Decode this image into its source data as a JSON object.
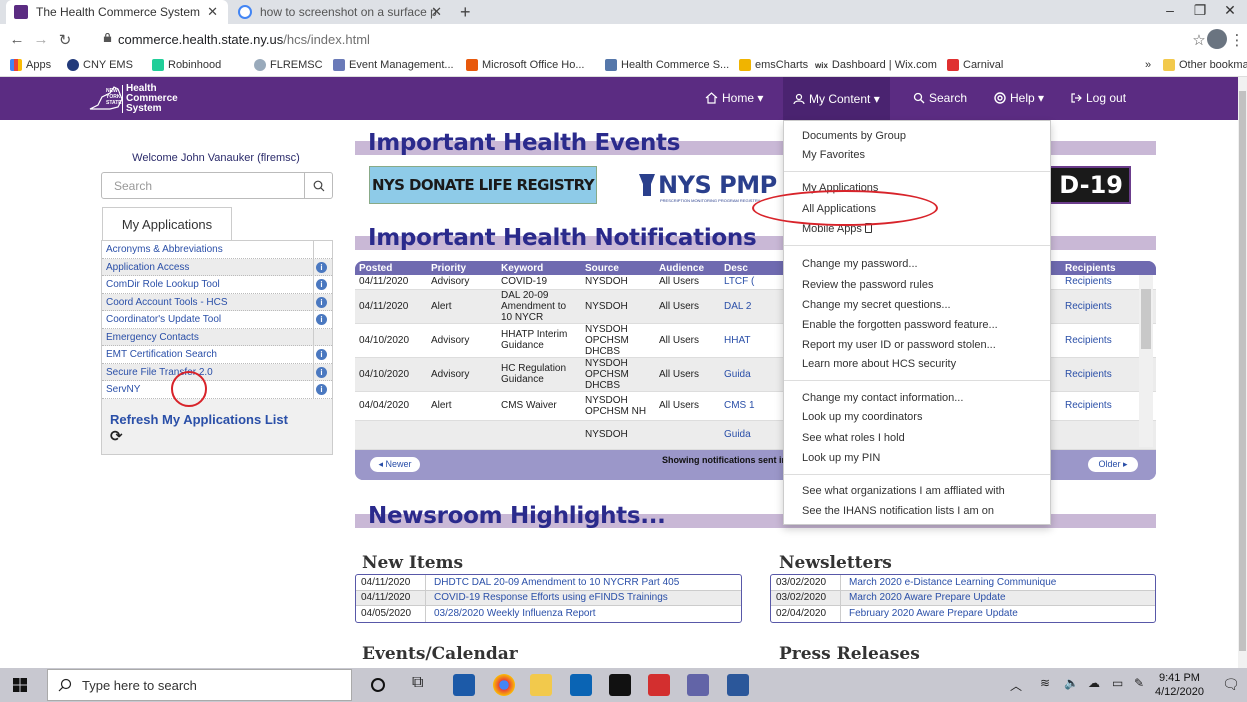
{
  "browser": {
    "tabs": [
      {
        "title": "The Health Commerce System",
        "active": true,
        "color": "#5b2c82"
      },
      {
        "title": "how to screenshot on a surface p",
        "active": false,
        "color": "#4285f4"
      }
    ],
    "url_host": "commerce.health.state.ny.us",
    "url_path": "/hcs/index.html",
    "bookmarks": [
      "Apps",
      "CNY EMS",
      "Robinhood",
      "FLREMSC",
      "Event Management...",
      "Microsoft Office Ho...",
      "Health Commerce S...",
      "emsCharts",
      "Dashboard | Wix.com",
      "Carnival"
    ],
    "other_bookmarks": "Other bookmarks",
    "overflow": "»"
  },
  "header": {
    "logo_line1": "NEW",
    "logo_line2": "YORK",
    "logo_line3": "STATE",
    "logo_name1": "Health",
    "logo_name2": "Commerce",
    "logo_name3": "System",
    "nav": {
      "home": "Home ▾",
      "my_content": "My Content ▾",
      "search": "Search",
      "help": "Help ▾",
      "logout": "Log out"
    }
  },
  "sidebar": {
    "welcome": "Welcome John Vanauker (flremsc)",
    "search_placeholder": "Search",
    "apps_tab": "My Applications",
    "apps": [
      {
        "label": "Acronyms & Abbreviations",
        "info": false
      },
      {
        "label": "Application Access",
        "info": true
      },
      {
        "label": "ComDir Role Lookup Tool",
        "info": true
      },
      {
        "label": "Coord Account Tools - HCS",
        "info": true
      },
      {
        "label": "Coordinator's Update Tool",
        "info": true
      },
      {
        "label": "Emergency Contacts",
        "info": false
      },
      {
        "label": "EMT Certification Search",
        "info": true
      },
      {
        "label": "Secure File Transfer 2.0",
        "info": true
      },
      {
        "label": "ServNY",
        "info": true
      }
    ],
    "refresh": "Refresh My Applications List",
    "refresh_icon": "⟳"
  },
  "main": {
    "events_title": "Important Health Events",
    "donate_banner": "NYS DONATE LIFE REGISTRY",
    "pmp_banner": "NYS PMP",
    "pmp_sub": "PRESCRIPTION MONITORING PROGRAM REGISTRY",
    "covid_banner": "D-19",
    "notifications_title": "Important Health Notifications",
    "notif_columns": [
      "Posted",
      "Priority",
      "Keyword",
      "Source",
      "Audience",
      "Desc",
      "Recipients"
    ],
    "notif_rows": [
      {
        "posted": "04/11/2020",
        "priority": "Advisory",
        "keyword": "COVID-19",
        "source": "NYSDOH",
        "audience": "All Users",
        "desc": "LTCF (",
        "recipients": "Recipients"
      },
      {
        "posted": "04/11/2020",
        "priority": "Alert",
        "keyword": "DAL 20-09 Amendment to 10 NYCR",
        "source": "NYSDOH",
        "audience": "All Users",
        "desc": "DAL 2",
        "recipients": "Recipients"
      },
      {
        "posted": "04/10/2020",
        "priority": "Advisory",
        "keyword": "HHATP Interim Guidance",
        "source": "NYSDOH OPCHSM DHCBS",
        "audience": "All Users",
        "desc": "HHAT",
        "recipients": "Recipients"
      },
      {
        "posted": "04/10/2020",
        "priority": "Advisory",
        "keyword": "HC Regulation Guidance",
        "source": "NYSDOH OPCHSM DHCBS",
        "audience": "All Users",
        "desc": "Guida",
        "recipients": "Recipients"
      },
      {
        "posted": "04/04/2020",
        "priority": "Alert",
        "keyword": "CMS Waiver",
        "source": "NYSDOH OPCHSM NH",
        "audience": "All Users",
        "desc": "CMS 1",
        "recipients": "Recipients"
      },
      {
        "posted": "",
        "priority": "",
        "keyword": "",
        "source": "NYSDOH",
        "audience": "",
        "desc": "Guida",
        "recipients": ""
      }
    ],
    "newer": "◂ Newer",
    "older": "Older ▸",
    "showing": "Showing notifications sent in",
    "newsroom_title": "Newsroom Highlights...",
    "new_items_title": "New Items",
    "new_items": [
      {
        "date": "04/11/2020",
        "title": "DHDTC DAL 20-09 Amendment to 10 NYCRR Part 405"
      },
      {
        "date": "04/11/2020",
        "title": "COVID-19 Response Efforts using eFINDS Trainings"
      },
      {
        "date": "04/05/2020",
        "title": "03/28/2020 Weekly Influenza Report"
      }
    ],
    "newsletters_title": "Newsletters",
    "newsletters": [
      {
        "date": "03/02/2020",
        "title": "March 2020 e-Distance Learning Communique"
      },
      {
        "date": "03/02/2020",
        "title": "March 2020 Aware Prepare Update"
      },
      {
        "date": "02/04/2020",
        "title": "February 2020 Aware Prepare Update"
      }
    ],
    "events_calendar_title": "Events/Calendar",
    "press_title": "Press Releases"
  },
  "dropdown": {
    "groups": [
      [
        "Documents by Group",
        "My Favorites"
      ],
      [
        "My Applications",
        "All Applications",
        "Mobile Apps"
      ],
      [
        "Change my password...",
        "Review the password rules",
        "Change my secret questions...",
        "Enable the forgotten password feature...",
        "Report my user ID or password stolen...",
        "Learn more about HCS security"
      ],
      [
        "Change my contact information...",
        "Look up my coordinators",
        "See what roles I hold",
        "Look up my PIN"
      ],
      [
        "See what organizations I am affliated with",
        "See the IHANS notification lists I am on"
      ]
    ]
  },
  "taskbar": {
    "search_placeholder": "Type here to search",
    "time": "9:41 PM",
    "date": "4/12/2020"
  },
  "colors": {
    "brand_purple": "#5b2c82",
    "link_blue": "#2a4fa8",
    "title_blue": "#2a2a8c",
    "highlight_red": "#d8232a"
  }
}
